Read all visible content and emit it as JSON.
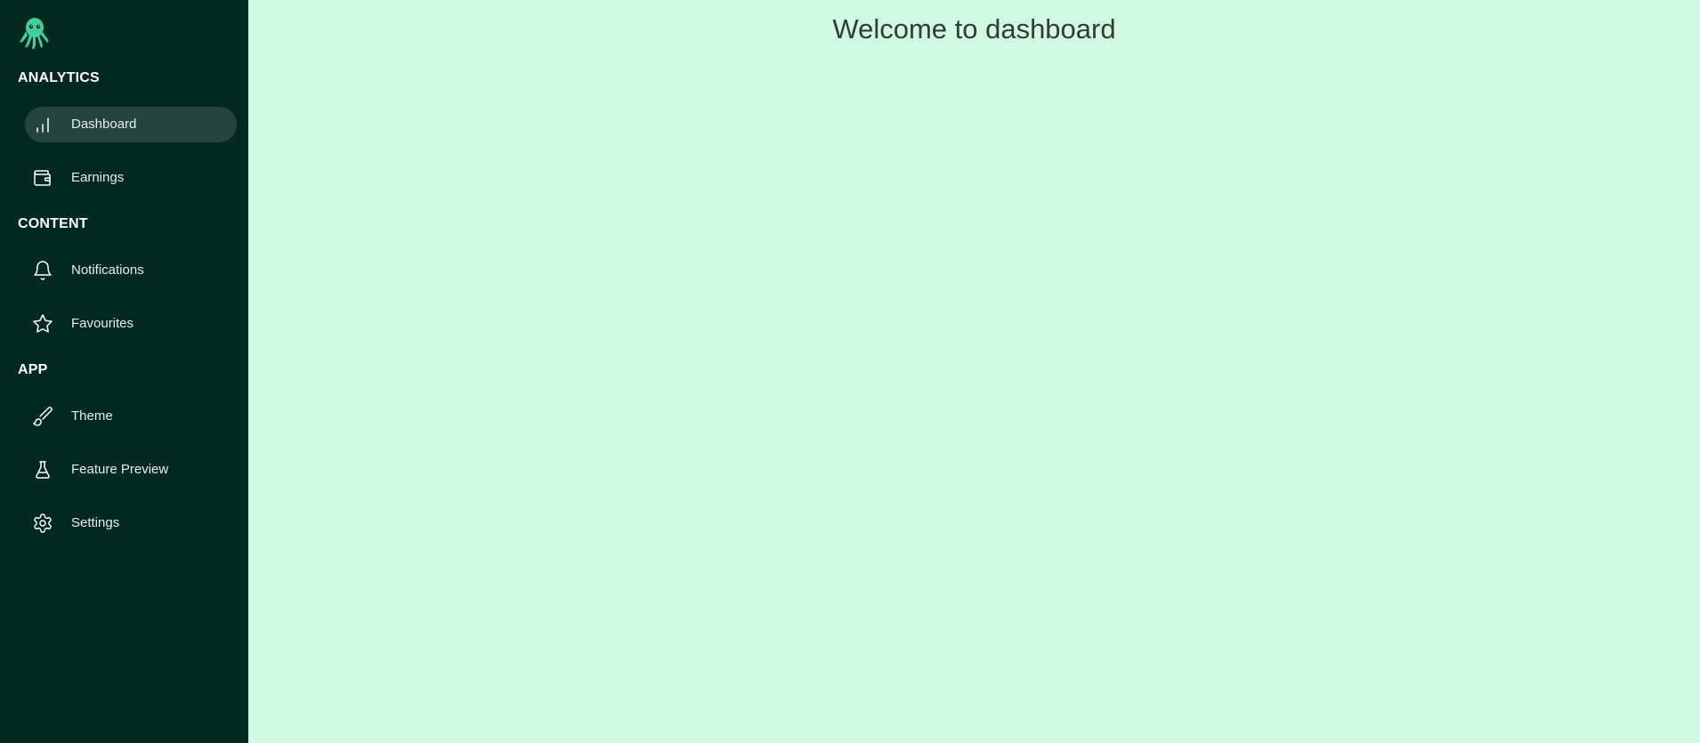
{
  "sidebar": {
    "logo_icon": "octopus-logo",
    "sections": [
      {
        "title": "ANALYTICS",
        "items": [
          {
            "label": "Dashboard",
            "icon": "bar-chart-icon",
            "active": true
          },
          {
            "label": "Earnings",
            "icon": "wallet-icon",
            "active": false
          }
        ]
      },
      {
        "title": "CONTENT",
        "items": [
          {
            "label": "Notifications",
            "icon": "bell-icon",
            "active": false
          },
          {
            "label": "Favourites",
            "icon": "star-icon",
            "active": false
          }
        ]
      },
      {
        "title": "APP",
        "items": [
          {
            "label": "Theme",
            "icon": "brush-icon",
            "active": false
          },
          {
            "label": "Feature Preview",
            "icon": "flask-icon",
            "active": false
          },
          {
            "label": "Settings",
            "icon": "gear-icon",
            "active": false
          }
        ]
      }
    ]
  },
  "main": {
    "title": "Welcome to dashboard"
  },
  "colors": {
    "sidebar_bg": "#032921",
    "active_item_bg": "#24443d",
    "main_bg": "#d0f9e4",
    "logo_accent": "#3ecf9a"
  }
}
